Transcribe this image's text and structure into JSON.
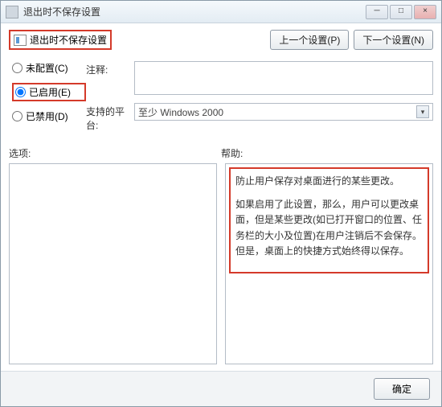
{
  "window": {
    "title": "退出时不保存设置",
    "min": "─",
    "max": "□",
    "close": "×"
  },
  "setting": {
    "name": "退出时不保存设置"
  },
  "nav": {
    "prev": "上一个设置(P)",
    "next": "下一个设置(N)"
  },
  "radios": {
    "unconfigured": "未配置(C)",
    "enabled": "已启用(E)",
    "disabled": "已禁用(D)"
  },
  "labels": {
    "comment": "注释:",
    "platform": "支持的平台:",
    "options": "选项:",
    "help": "帮助:"
  },
  "fields": {
    "comment": "",
    "platform": "至少 Windows 2000"
  },
  "help": {
    "p1": "防止用户保存对桌面进行的某些更改。",
    "p2": "如果启用了此设置，那么，用户可以更改桌面，但是某些更改(如已打开窗口的位置、任务栏的大小及位置)在用户注销后不会保存。但是，桌面上的快捷方式始终得以保存。"
  },
  "buttons": {
    "ok": "确定"
  }
}
